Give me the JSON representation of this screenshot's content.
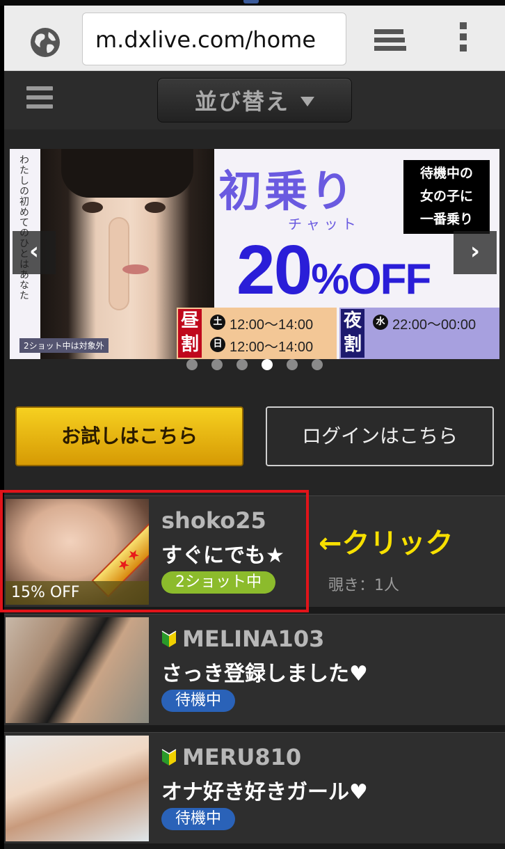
{
  "browser": {
    "url": "m.dxlive.com/home"
  },
  "header": {
    "sort_label": "並び替え"
  },
  "banner": {
    "vertical_text": "わたしの初めてのひとはあなた",
    "title": "初乗り",
    "subtitle": "チャット",
    "box_lines": [
      "待機中の",
      "女の子に",
      "一番乗り"
    ],
    "discount": "20",
    "discount_unit": "%OFF",
    "note": "2ショット中は対象外",
    "day_tag": [
      "昼",
      "割"
    ],
    "night_tag": [
      "夜",
      "割"
    ],
    "day_schedule": [
      {
        "day": "土",
        "time": "12:00～14:00"
      },
      {
        "day": "日",
        "time": "12:00～14:00"
      }
    ],
    "night_schedule": [
      {
        "day": "水",
        "time": "22:00～00:00"
      }
    ],
    "slides_total": 6,
    "active_slide": 4
  },
  "actions": {
    "trial_label": "お試しはこちら",
    "login_label": "ログインはこちら"
  },
  "performers": [
    {
      "name": "shoko25",
      "message": "すぐにでも★",
      "status": "2ショット中",
      "discount": "15% OFF",
      "watchers": "覗き：1人",
      "ribbon": "★★"
    },
    {
      "name": "MELINA103",
      "message": "さっき登録しました♥",
      "status": "待機中"
    },
    {
      "name": "MERU810",
      "message": "オナ好き好きガール♥",
      "status": "待機中"
    }
  ],
  "annotation": {
    "click_label": "←クリック"
  },
  "colors": {
    "highlight": "#e1141a",
    "trial_button": "#f0c010",
    "status_two_shot": "#8cbb2c",
    "status_waiting": "#2a62b8"
  }
}
